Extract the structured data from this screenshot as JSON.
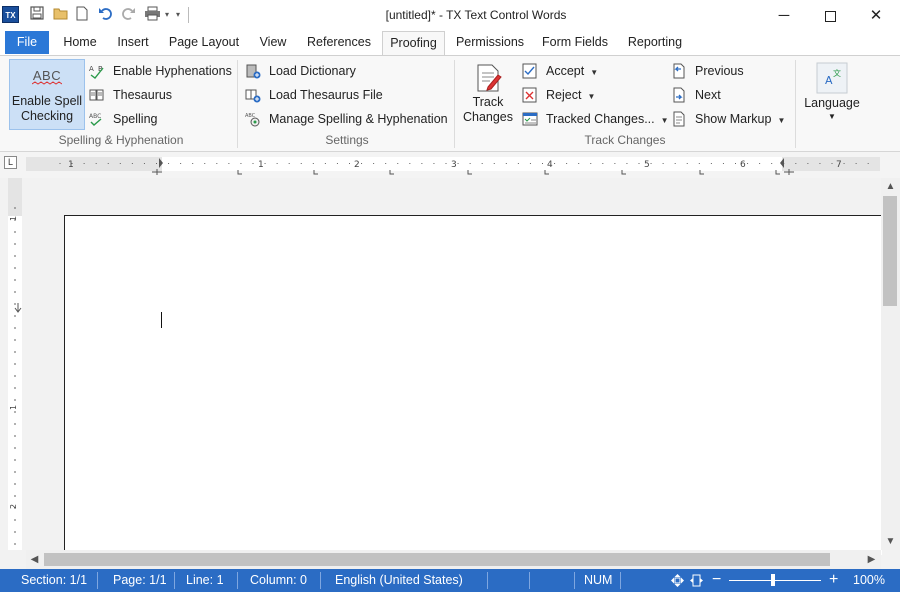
{
  "titlebar": {
    "title": "[untitled]* - TX Text Control Words",
    "app_icon_text": "TX"
  },
  "tabs": [
    {
      "label": "File"
    },
    {
      "label": "Home"
    },
    {
      "label": "Insert"
    },
    {
      "label": "Page Layout"
    },
    {
      "label": "View"
    },
    {
      "label": "References"
    },
    {
      "label": "Proofing"
    },
    {
      "label": "Permissions"
    },
    {
      "label": "Form Fields"
    },
    {
      "label": "Reporting"
    }
  ],
  "active_tab": "Proofing",
  "ribbon": {
    "spelling_group": {
      "label": "Spelling & Hyphenation",
      "enable_spell_checking": {
        "line1": "Enable Spell",
        "line2": "Checking",
        "icon_text": "ABC"
      },
      "enable_hyphenations": "Enable Hyphenations",
      "thesaurus": "Thesaurus",
      "spelling": "Spelling"
    },
    "settings_group": {
      "label": "Settings",
      "load_dictionary": "Load Dictionary",
      "load_thesaurus_file": "Load Thesaurus File",
      "manage": "Manage Spelling & Hyphenation"
    },
    "track_group": {
      "label": "Track Changes",
      "track_changes": {
        "line1": "Track",
        "line2": "Changes"
      },
      "accept": "Accept",
      "reject": "Reject",
      "tracked_changes": "Tracked Changes...",
      "previous": "Previous",
      "next": "Next",
      "show_markup": "Show Markup"
    },
    "language": {
      "label": "Language"
    }
  },
  "ruler": {
    "numbers": [
      "1",
      "1",
      "2",
      "3",
      "4",
      "5",
      "6",
      "7"
    ]
  },
  "vruler_numbers": [
    "1",
    "1",
    "2"
  ],
  "statusbar": {
    "section": "Section: 1/1",
    "page": "Page: 1/1",
    "line": "Line: 1",
    "column": "Column: 0",
    "language": "English (United States)",
    "num": "NUM",
    "zoom": "100%"
  },
  "colors": {
    "accent": "#2b78d7",
    "statusbar": "#2b6cc4",
    "selected": "#cce0f6"
  }
}
